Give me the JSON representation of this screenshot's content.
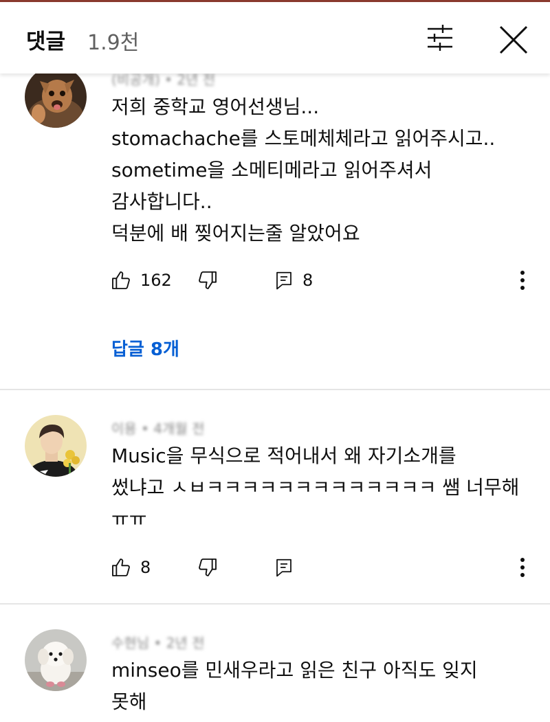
{
  "header": {
    "title": "댓글",
    "count": "1.9천",
    "filter_icon": "sliders-icon",
    "close_icon": "close-icon"
  },
  "comments": [
    {
      "meta": "(비공개) • 2년 전",
      "lines": [
        "저희 중학교 영어선생님...",
        "stomachache를 스토메체체라고 읽어주시고..",
        "sometime을 소메티메라고 읽어주셔서",
        "감사합니다..",
        "덕분에 배 찢어지는줄 알았어요"
      ],
      "likes": "162",
      "reply_count": "8",
      "replies_link": "답글 8개"
    },
    {
      "meta": "이용 • 4개월 전",
      "lines": [
        "Music을 무식으로 적어내서 왜 자기소개를",
        "썼냐고 ㅅㅂㅋㅋㅋㅋㅋㅋㅋㅋㅋㅋㅋㅋㅋ 쌤 너무해",
        "ㅠㅠ"
      ],
      "likes": "8"
    },
    {
      "meta": "수현님 • 2년 전",
      "lines": [
        "minseo를 민새우라고 읽은 친구 아직도 잊지",
        "못해"
      ]
    }
  ],
  "colors": {
    "link": "#065fd4",
    "secondary_text": "#606060",
    "divider": "#e5e5e5",
    "top_rule": "#8a3a2e"
  }
}
